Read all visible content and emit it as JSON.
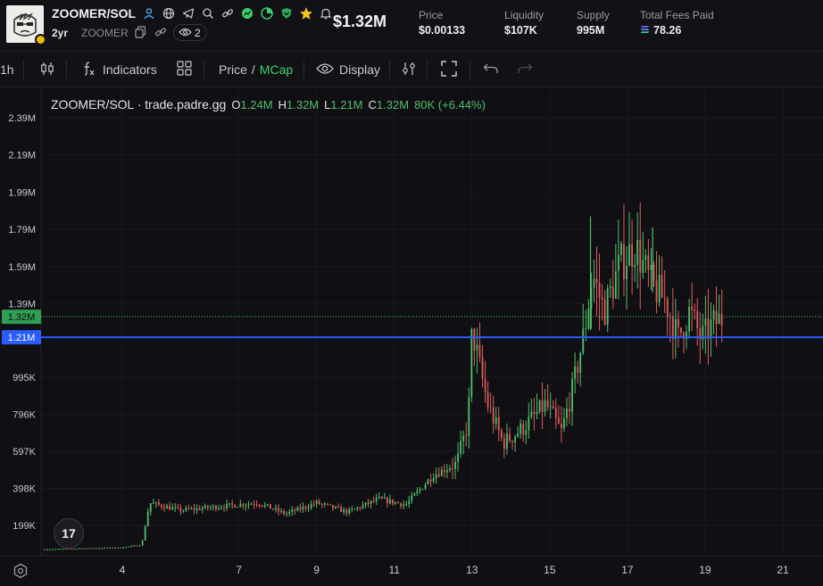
{
  "header": {
    "pair": "ZOOMER/SOL",
    "age": "2yr",
    "ticker": "ZOOMER",
    "watchers": "2",
    "market_cap": "$1.32M",
    "icons": [
      "user-icon",
      "globe-icon",
      "telegram-icon",
      "search-icon",
      "link-icon",
      "chart-icon",
      "pie-icon",
      "shield-icon",
      "star-icon",
      "bell-icon"
    ],
    "stats": [
      {
        "label": "Price",
        "value": "$0.00133"
      },
      {
        "label": "Liquidity",
        "value": "$107K"
      },
      {
        "label": "Supply",
        "value": "995M"
      },
      {
        "label": "Total Fees Paid",
        "value": "78.26"
      }
    ],
    "accent_star": "#f5c518",
    "accent_green": "#3ccf6b"
  },
  "toolbar": {
    "interval": "1h",
    "indicators": "Indicators",
    "price": "Price",
    "slash": "/",
    "mcap": "MCap",
    "display": "Display"
  },
  "legend": {
    "title": "ZOOMER/SOL · trade.padre.gg",
    "o_key": "O",
    "o": "1.24M",
    "h_key": "H",
    "h": "1.32M",
    "l_key": "L",
    "l": "1.21M",
    "c_key": "C",
    "c": "1.32M",
    "change": "80K (+6.44%)"
  },
  "tv_logo": "17",
  "chart_data": {
    "type": "candlestick",
    "x_ticks": [
      "4",
      "7",
      "9",
      "11",
      "13",
      "15",
      "17",
      "19",
      "21"
    ],
    "x_tick_days": [
      4,
      7,
      9,
      11,
      13,
      15,
      17,
      19,
      21
    ],
    "y_ticks": [
      "2.39M",
      "2.19M",
      "1.99M",
      "1.79M",
      "1.59M",
      "1.39M",
      "995K",
      "796K",
      "597K",
      "398K",
      "199K"
    ],
    "y_tick_values": [
      2390000,
      2190000,
      1990000,
      1790000,
      1590000,
      1390000,
      995000,
      796000,
      597000,
      398000,
      199000
    ],
    "last_price_label": "1.32M",
    "last_price": 1320000,
    "crosshair_label": "1.21M",
    "crosshair_price": 1210000,
    "up_color": "#4fbf6a",
    "down_color": "#e05c5c",
    "crosshair_color": "#2a5cff",
    "series_points": [
      [
        2.0,
        70000
      ],
      [
        3.0,
        75000
      ],
      [
        4.0,
        80000
      ],
      [
        4.5,
        95000
      ],
      [
        4.7,
        320000
      ],
      [
        5.5,
        280000
      ],
      [
        6.5,
        300000
      ],
      [
        7.5,
        320000
      ],
      [
        8.2,
        260000
      ],
      [
        9.0,
        320000
      ],
      [
        9.8,
        270000
      ],
      [
        10.6,
        340000
      ],
      [
        11.3,
        310000
      ],
      [
        12.0,
        470000
      ],
      [
        12.6,
        530000
      ],
      [
        12.9,
        750000
      ],
      [
        13.0,
        1250000
      ],
      [
        13.4,
        850000
      ],
      [
        13.8,
        640000
      ],
      [
        14.3,
        720000
      ],
      [
        14.9,
        850000
      ],
      [
        15.3,
        700000
      ],
      [
        15.6,
        940000
      ],
      [
        15.9,
        1250000
      ],
      [
        16.1,
        1550000
      ],
      [
        16.4,
        1350000
      ],
      [
        16.8,
        1600000
      ],
      [
        17.2,
        1700000
      ],
      [
        17.6,
        1500000
      ],
      [
        18.0,
        1400000
      ],
      [
        18.3,
        1200000
      ],
      [
        18.6,
        1350000
      ],
      [
        18.9,
        1200000
      ],
      [
        19.2,
        1280000
      ],
      [
        19.5,
        1320000
      ]
    ],
    "grid": true
  }
}
